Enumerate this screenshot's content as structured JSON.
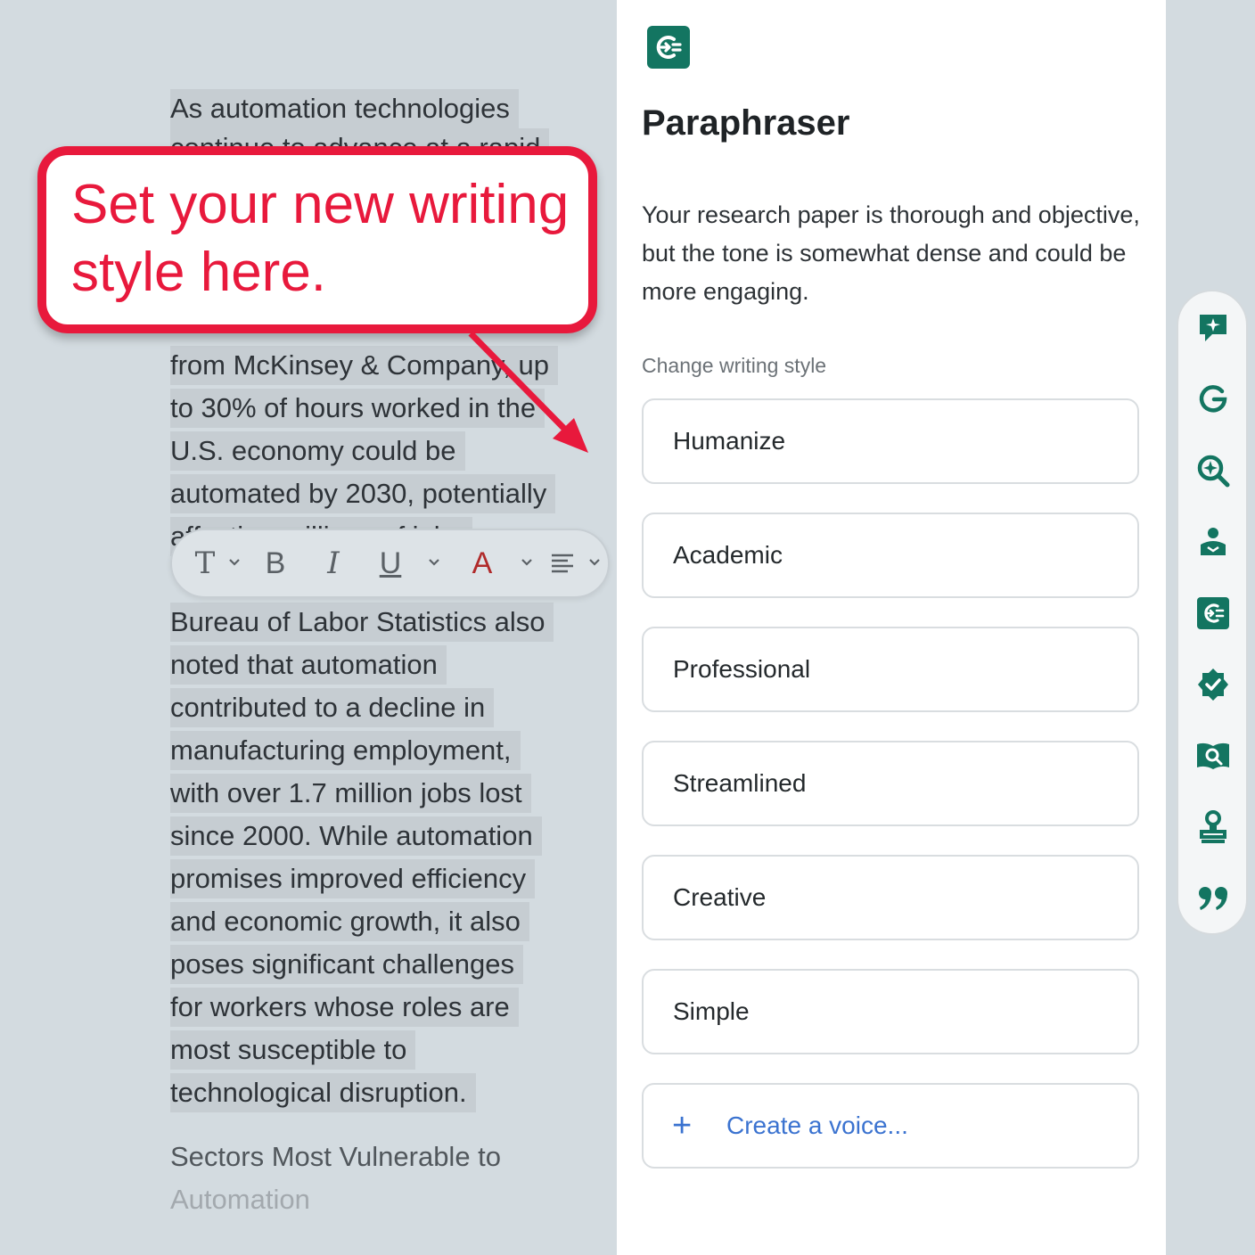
{
  "document": {
    "lines": [
      {
        "text": "As automation technologies",
        "style": "sel"
      },
      {
        "text": "continue to advance at a rapid",
        "style": "sel"
      },
      {
        "text": "from McKinsey & Company, up",
        "style": "sel"
      },
      {
        "text": "to 30% of hours worked in the",
        "style": "sel"
      },
      {
        "text": "U.S. economy could be",
        "style": "sel"
      },
      {
        "text": "automated by 2030, potentially",
        "style": "sel"
      },
      {
        "text": "affecting millions of jobs",
        "style": "sel"
      },
      {
        "text": "Bureau of Labor Statistics also",
        "style": "sel"
      },
      {
        "text": "noted that automation",
        "style": "sel"
      },
      {
        "text": "contributed to a decline in",
        "style": "sel"
      },
      {
        "text": "manufacturing employment,",
        "style": "sel"
      },
      {
        "text": "with over 1.7 million jobs lost",
        "style": "sel"
      },
      {
        "text": "since 2000. While automation",
        "style": "sel"
      },
      {
        "text": "promises improved efficiency",
        "style": "sel"
      },
      {
        "text": "and economic growth, it also",
        "style": "sel"
      },
      {
        "text": "poses significant challenges",
        "style": "sel"
      },
      {
        "text": "for workers whose roles are",
        "style": "sel"
      },
      {
        "text": "most susceptible to",
        "style": "sel"
      },
      {
        "text": "technological disruption.",
        "style": "sel"
      },
      {
        "text": "Sectors Most Vulnerable to",
        "style": "plain"
      },
      {
        "text": "Automation",
        "style": "faded"
      }
    ]
  },
  "callout": {
    "text": "Set your new writing style here.",
    "color": "#e8193c"
  },
  "toolbar": {
    "text_style_glyph": "T",
    "bold_glyph": "B",
    "italic_glyph": "I",
    "underline_glyph": "U",
    "font_color_glyph": "A",
    "font_color": "#b02a2a",
    "icons": [
      "text-style-icon",
      "chevron-down-icon",
      "bold-icon",
      "italic-icon",
      "underline-icon",
      "font-color-icon",
      "align-icon"
    ]
  },
  "panel": {
    "title": "Paraphraser",
    "description": "Your research paper is thorough and objective, but the tone is somewhat dense and could be more engaging.",
    "style_label": "Change writing style",
    "styles": [
      "Humanize",
      "Academic",
      "Professional",
      "Streamlined",
      "Creative",
      "Simple"
    ],
    "create_voice": "Create a voice...",
    "create_voice_glyph": "+",
    "accent": "#137561",
    "link_color": "#3b73d0"
  },
  "rail": {
    "items": [
      "sparkle-chat-icon",
      "grammarly-g-icon",
      "sparkle-search-icon",
      "reader-icon",
      "paraphraser-icon",
      "verified-badge-icon",
      "book-search-icon",
      "stamp-icon",
      "quote-icon"
    ],
    "active": "paraphraser-icon"
  }
}
